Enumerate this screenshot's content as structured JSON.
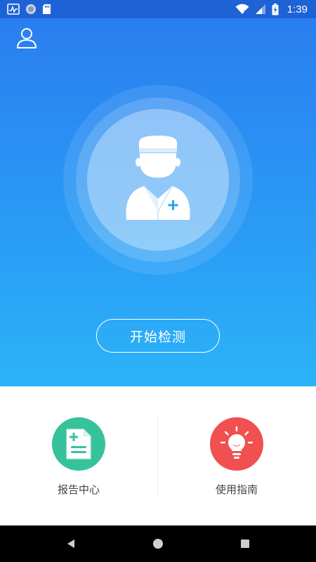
{
  "status_bar": {
    "time": "1:39",
    "left_icons": [
      "activity-icon",
      "circle-icon",
      "sd-card-icon"
    ],
    "right_icons": [
      "wifi-icon",
      "signal-icon",
      "battery-charging-icon"
    ]
  },
  "hero": {
    "user_icon": "user-icon",
    "illustration_icon": "doctor-icon",
    "start_button_label": "开始检测",
    "gradient_top": "#2a7ef0",
    "gradient_bottom": "#2bb3f8"
  },
  "features": {
    "report": {
      "label": "报告中心",
      "icon": "report-document-icon",
      "color": "#36c29b"
    },
    "guide": {
      "label": "使用指南",
      "icon": "lightbulb-icon",
      "color": "#f05050"
    }
  },
  "nav_bar": {
    "buttons": [
      "back-icon",
      "home-icon",
      "recents-icon"
    ]
  }
}
